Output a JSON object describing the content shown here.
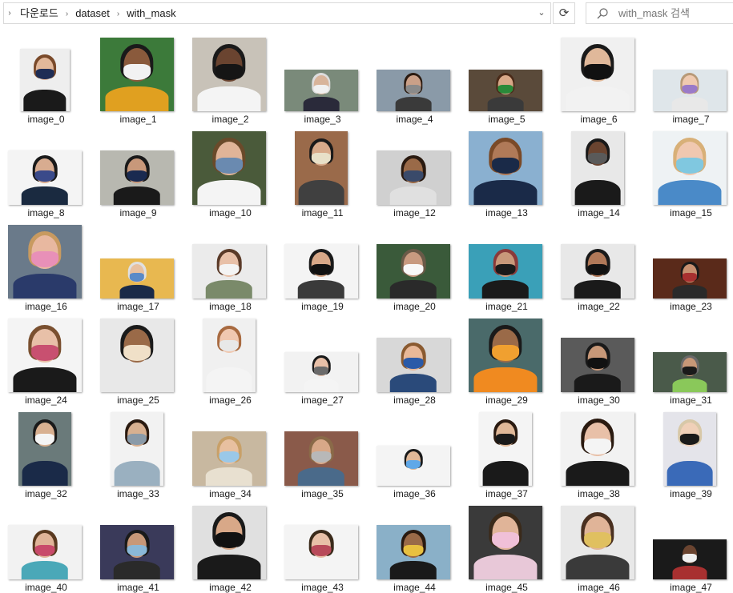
{
  "address_bar": {
    "breadcrumbs": [
      "다운로드",
      "dataset",
      "with_mask"
    ]
  },
  "search": {
    "placeholder": "with_mask 검색"
  },
  "files": [
    {
      "name": "image_0",
      "bg": "#eeeeee",
      "skin": "#e2b89a",
      "hair": "#7a4a2a",
      "cloth": "#1a1a1a",
      "mask": "#1f2d55",
      "shape": "portrait-small"
    },
    {
      "name": "image_1",
      "bg": "#3c7a3a",
      "skin": "#8a5a3c",
      "hair": "#1a1a1a",
      "cloth": "#e0a020",
      "mask": "#f2f2f2",
      "shape": "square"
    },
    {
      "name": "image_2",
      "bg": "#c8c2b8",
      "skin": "#6a4430",
      "hair": "#1a1a1a",
      "cloth": "#f4f4f4",
      "mask": "#151515",
      "shape": "tall"
    },
    {
      "name": "image_3",
      "bg": "#7a8a7a",
      "skin": "#d8b49a",
      "hair": "#dddddd",
      "cloth": "#2a2a3a",
      "mask": "#f0f0f0",
      "shape": "wide"
    },
    {
      "name": "image_4",
      "bg": "#8a9aa8",
      "skin": "#caa088",
      "hair": "#2a1a10",
      "cloth": "#3a3a3a",
      "mask": "#8a8a8a",
      "shape": "wide"
    },
    {
      "name": "image_5",
      "bg": "#5a4a3a",
      "skin": "#d8a888",
      "hair": "#4a2a18",
      "cloth": "#3a3a3a",
      "mask": "#2a8a3a",
      "shape": "wide"
    },
    {
      "name": "image_6",
      "bg": "#f0f0f0",
      "skin": "#e0b89a",
      "hair": "#1a1a1a",
      "cloth": "#f2f2f2",
      "mask": "#111111",
      "shape": "square"
    },
    {
      "name": "image_7",
      "bg": "#dfe6ea",
      "skin": "#f0cab0",
      "hair": "#b89a78",
      "cloth": "#e8e8e8",
      "mask": "#9a7ac8",
      "shape": "wide"
    },
    {
      "name": "image_8",
      "bg": "#f4f4f4",
      "skin": "#d8ac90",
      "hair": "#1a1a1a",
      "cloth": "#1a2a40",
      "mask": "#3a4a8a",
      "shape": "wide-tall"
    },
    {
      "name": "image_9",
      "bg": "#b8b8b0",
      "skin": "#c8987a",
      "hair": "#1a1a1a",
      "cloth": "#1a1a1a",
      "mask": "#1a2a50",
      "shape": "wide-tall"
    },
    {
      "name": "image_10",
      "bg": "#4a5a3a",
      "skin": "#e0b498",
      "hair": "#6a4a2a",
      "cloth": "#f4f4f4",
      "mask": "#6a8ab0",
      "shape": "square"
    },
    {
      "name": "image_11",
      "bg": "#9a6a4a",
      "skin": "#d8aa8a",
      "hair": "#1a1a1a",
      "cloth": "#404040",
      "mask": "#e8e0c8",
      "shape": "tall-narrow"
    },
    {
      "name": "image_12",
      "bg": "#d0d0d0",
      "skin": "#9a6a48",
      "hair": "#2a1a10",
      "cloth": "#e0e0e0",
      "mask": "#3a4a6a",
      "shape": "wide-tall"
    },
    {
      "name": "image_13",
      "bg": "#8ab0d0",
      "skin": "#b07a58",
      "hair": "#7a4a28",
      "cloth": "#1a2a48",
      "mask": "#1a2a48",
      "shape": "square"
    },
    {
      "name": "image_14",
      "bg": "#e8e8e8",
      "skin": "#6a4430",
      "hair": "#1a1a1a",
      "cloth": "#1a1a1a",
      "mask": "#5a5a5a",
      "shape": "tall-narrow"
    },
    {
      "name": "image_15",
      "bg": "#eef2f4",
      "skin": "#f0c8b0",
      "hair": "#d8b078",
      "cloth": "#4a8ac8",
      "mask": "#80c8e0",
      "shape": "square"
    },
    {
      "name": "image_16",
      "bg": "#6a7a8a",
      "skin": "#e8b8a0",
      "hair": "#c89a60",
      "cloth": "#2a3a6a",
      "mask": "#e890b8",
      "shape": "square"
    },
    {
      "name": "image_17",
      "bg": "#e8b850",
      "skin": "#e8c0a0",
      "hair": "#e0e0e0",
      "cloth": "#1a2a48",
      "mask": "#5a8ac8",
      "shape": "wide-short"
    },
    {
      "name": "image_18",
      "bg": "#ebebeb",
      "skin": "#e8c0a8",
      "hair": "#5a3a28",
      "cloth": "#7a8a6a",
      "mask": "#f4f4f4",
      "shape": "wide-tall"
    },
    {
      "name": "image_19",
      "bg": "#f4f4f4",
      "skin": "#d8a888",
      "hair": "#1a1a1a",
      "cloth": "#3a3a3a",
      "mask": "#111111",
      "shape": "wide-tall"
    },
    {
      "name": "image_20",
      "bg": "#3a5a3a",
      "skin": "#c89a80",
      "hair": "#6a5a48",
      "cloth": "#2a2a2a",
      "mask": "#f8f8f8",
      "shape": "wide-tall"
    },
    {
      "name": "image_21",
      "bg": "#3aa0b8",
      "skin": "#c8987a",
      "hair": "#8a3a3a",
      "cloth": "#1a1a1a",
      "mask": "#1a1a1a",
      "shape": "wide-tall"
    },
    {
      "name": "image_22",
      "bg": "#e8e8e8",
      "skin": "#b07858",
      "hair": "#1a1a1a",
      "cloth": "#1a1a1a",
      "mask": "#111111",
      "shape": "wide-tall"
    },
    {
      "name": "image_23",
      "bg": "#5a2a1a",
      "skin": "#c89070",
      "hair": "#1a1a1a",
      "cloth": "#2a2a2a",
      "mask": "#a83030",
      "shape": "wide-short"
    },
    {
      "name": "image_24",
      "bg": "#f4f4f4",
      "skin": "#e8c0a8",
      "hair": "#7a5030",
      "cloth": "#1a1a1a",
      "mask": "#c85070",
      "shape": "square"
    },
    {
      "name": "image_25",
      "bg": "#e8e8e8",
      "skin": "#9a6a48",
      "hair": "#1a1a1a",
      "cloth": "#e8e8e8",
      "mask": "#f0e0c8",
      "shape": "square"
    },
    {
      "name": "image_26",
      "bg": "#f0f0f0",
      "skin": "#f0c8b0",
      "hair": "#a86a40",
      "cloth": "#f4f4f4",
      "mask": "#e8e8e8",
      "shape": "tall-narrow"
    },
    {
      "name": "image_27",
      "bg": "#f2f2f2",
      "skin": "#e8c0a8",
      "hair": "#1a1a1a",
      "cloth": "#f4f4f4",
      "mask": "#6a6a6a",
      "shape": "wide-short"
    },
    {
      "name": "image_28",
      "bg": "#d8d8d8",
      "skin": "#e8b898",
      "hair": "#8a5a30",
      "cloth": "#2a4a7a",
      "mask": "#2a5aa8",
      "shape": "wide-tall"
    },
    {
      "name": "image_29",
      "bg": "#4a6a6a",
      "skin": "#9a6a48",
      "hair": "#1a1a1a",
      "cloth": "#f08a20",
      "mask": "#f0a030",
      "shape": "square"
    },
    {
      "name": "image_30",
      "bg": "#5a5a5a",
      "skin": "#c89878",
      "hair": "#1a1a1a",
      "cloth": "#1a1a1a",
      "mask": "#111111",
      "shape": "wide-tall"
    },
    {
      "name": "image_31",
      "bg": "#4a5a4a",
      "skin": "#c89878",
      "hair": "#6a6a6a",
      "cloth": "#8ac85a",
      "mask": "#1a1a1a",
      "shape": "wide-short"
    },
    {
      "name": "image_32",
      "bg": "#6a7a7a",
      "skin": "#d8b090",
      "hair": "#1a1a1a",
      "cloth": "#1a2a48",
      "mask": "#f4f4f4",
      "shape": "tall-narrow"
    },
    {
      "name": "image_33",
      "bg": "#f2f2f2",
      "skin": "#d8b090",
      "hair": "#2a1a10",
      "cloth": "#9ab0c0",
      "mask": "#8a9aa8",
      "shape": "tall-narrow"
    },
    {
      "name": "image_34",
      "bg": "#c8b8a0",
      "skin": "#e8c0a0",
      "hair": "#c8a068",
      "cloth": "#e8e0d0",
      "mask": "#9ac8e8",
      "shape": "wide-tall"
    },
    {
      "name": "image_35",
      "bg": "#8a5a4a",
      "skin": "#d8a888",
      "hair": "#8a6a48",
      "cloth": "#4a6a8a",
      "mask": "#b8b8b8",
      "shape": "wide-tall"
    },
    {
      "name": "image_36",
      "bg": "#f4f4f4",
      "skin": "#e0b898",
      "hair": "#1a1a1a",
      "cloth": "#f4f4f4",
      "mask": "#60a8e8",
      "shape": "wide-short"
    },
    {
      "name": "image_37",
      "bg": "#f4f4f4",
      "skin": "#e0b898",
      "hair": "#2a1a10",
      "cloth": "#1a1a1a",
      "mask": "#1a1a1a",
      "shape": "tall-narrow"
    },
    {
      "name": "image_38",
      "bg": "#f2f2f2",
      "skin": "#e8c0a8",
      "hair": "#2a1a10",
      "cloth": "#1a1a1a",
      "mask": "#f4f4f4",
      "shape": "square"
    },
    {
      "name": "image_39",
      "bg": "#e4e4ea",
      "skin": "#f0d0b8",
      "hair": "#d8c8a8",
      "cloth": "#3a6ab8",
      "mask": "#1a1a1a",
      "shape": "tall-narrow"
    },
    {
      "name": "image_40",
      "bg": "#f2f2f2",
      "skin": "#e0b498",
      "hair": "#5a3a20",
      "cloth": "#4aa8b8",
      "mask": "#c84a6a",
      "shape": "wide-tall"
    },
    {
      "name": "image_41",
      "bg": "#3a3a5a",
      "skin": "#c89878",
      "hair": "#1a1a1a",
      "cloth": "#2a2a2a",
      "mask": "#8ab8d8",
      "shape": "wide-tall"
    },
    {
      "name": "image_42",
      "bg": "#e0e0e0",
      "skin": "#d8a888",
      "hair": "#1a1a1a",
      "cloth": "#1a1a1a",
      "mask": "#111111",
      "shape": "square"
    },
    {
      "name": "image_43",
      "bg": "#f4f4f4",
      "skin": "#e8c0a8",
      "hair": "#3a2a1a",
      "cloth": "#f4f4f4",
      "mask": "#b84a5a",
      "shape": "wide-tall"
    },
    {
      "name": "image_44",
      "bg": "#8ab0c8",
      "skin": "#9a6a48",
      "hair": "#2a1a10",
      "cloth": "#1a1a1a",
      "mask": "#e8c040",
      "shape": "wide-tall"
    },
    {
      "name": "image_45",
      "bg": "#3a3a3a",
      "skin": "#e0b498",
      "hair": "#3a2a1a",
      "cloth": "#e8c8d8",
      "mask": "#f0c0d8",
      "shape": "square"
    },
    {
      "name": "image_46",
      "bg": "#e8e8e8",
      "skin": "#e0b498",
      "hair": "#4a3020",
      "cloth": "#3a3a3a",
      "mask": "#e0c060",
      "shape": "square"
    },
    {
      "name": "image_47",
      "bg": "#1a1a1a",
      "skin": "#6a4430",
      "hair": "#1a1a1a",
      "cloth": "#a83030",
      "mask": "#f0f0f0",
      "shape": "wide-short"
    }
  ]
}
